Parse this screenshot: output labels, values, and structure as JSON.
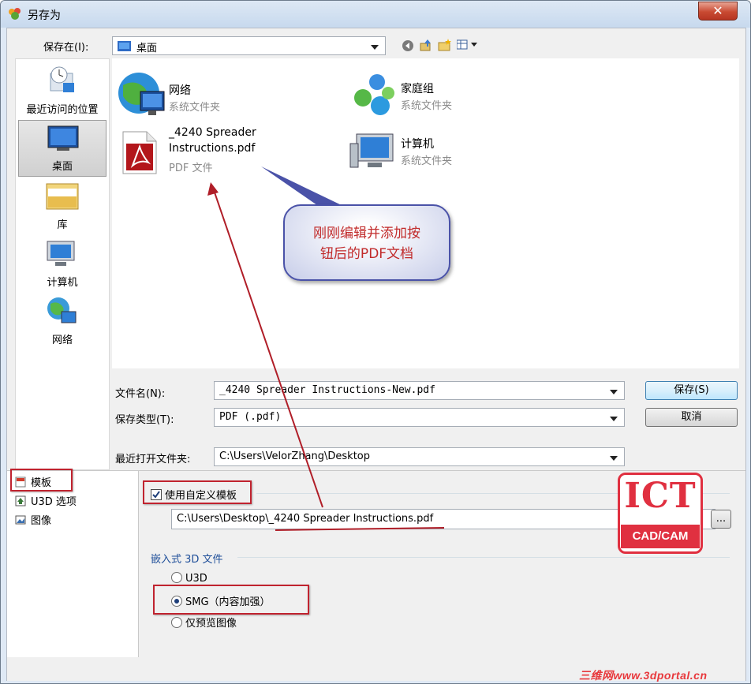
{
  "window": {
    "title": "另存为",
    "close_glyph": "✕"
  },
  "location": {
    "label": "保存在(I):",
    "value": "桌面"
  },
  "toolbar": {
    "icons": [
      "back-icon",
      "up-folder-icon",
      "new-folder-icon",
      "view-menu-icon"
    ]
  },
  "places": [
    {
      "label": "最近访问的位置",
      "icon": "recent-places-icon"
    },
    {
      "label": "桌面",
      "icon": "desktop-icon",
      "selected": true
    },
    {
      "label": "库",
      "icon": "libraries-icon"
    },
    {
      "label": "计算机",
      "icon": "computer-icon"
    },
    {
      "label": "网络",
      "icon": "network-icon"
    }
  ],
  "files": [
    {
      "name": "网络",
      "type": "系统文件夹",
      "icon": "network-icon"
    },
    {
      "name": "家庭组",
      "type": "系统文件夹",
      "icon": "homegroup-icon"
    },
    {
      "name_line1": "_4240 Spreader",
      "name_line2": "Instructions.pdf",
      "type": "PDF 文件",
      "icon": "pdf-icon"
    },
    {
      "name": "计算机",
      "type": "系统文件夹",
      "icon": "computer-icon"
    }
  ],
  "form": {
    "filename_label": "文件名(N):",
    "filename_value": "_4240 Spreader Instructions-New.pdf",
    "filetype_label": "保存类型(T):",
    "filetype_value": "PDF (.pdf)",
    "recent_label": "最近打开文件夹:",
    "recent_value": "C:\\Users\\VelorZhang\\Desktop",
    "save_button": "保存(S)",
    "cancel_button": "取消"
  },
  "options_tree": [
    {
      "label": "模板",
      "icon": "template-icon"
    },
    {
      "label": "U3D 选项",
      "icon": "u3d-icon"
    },
    {
      "label": "图像",
      "icon": "image-icon"
    }
  ],
  "template": {
    "use_custom_label": "使用自定义模板",
    "use_custom_checked": true,
    "path_value": "C:\\Users\\Desktop\\_4240 Spreader Instructions.pdf",
    "browse_button": "..."
  },
  "embed3d": {
    "group_title": "嵌入式 3D 文件",
    "options": [
      {
        "label": "U3D",
        "selected": false
      },
      {
        "label": "SMG（内容加强）",
        "selected": true
      },
      {
        "label": "仅预览图像",
        "selected": false
      }
    ]
  },
  "annotation": {
    "line1": "刚刚编辑并添加按",
    "line2": "钮后的PDF文档",
    "highlight_color": "#c0232f",
    "arrow_color": "#b01e28"
  },
  "logo": {
    "big": "ICT",
    "small": "CAD/CAM"
  },
  "watermark": "三维网www.3dportal.cn"
}
